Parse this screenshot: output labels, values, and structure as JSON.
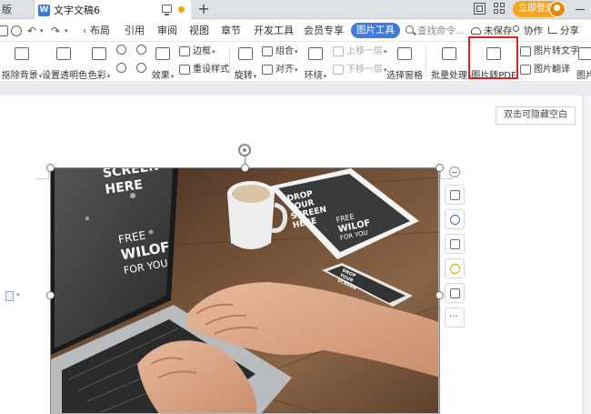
{
  "tabbar": {
    "prev_tab": "版",
    "doc_icon_letter": "W",
    "active_tab": "文字文稿6",
    "new_tab_label": "+",
    "login_label": "立即登录"
  },
  "menubar": {
    "items": {
      "layout": "布局",
      "reference": "引用",
      "review": "审阅",
      "view": "视图",
      "chapter": "章节",
      "devtools": "开发工具",
      "member": "会员专享",
      "picture_tools": "图片工具"
    },
    "search": "查找命令...",
    "unsaved": "未保存",
    "collab": "协作",
    "share": "分享"
  },
  "ribbon": {
    "remove_bg": "抠除背景",
    "set_transparent": "设置透明色",
    "color": "色彩",
    "effects": "效果",
    "border": "边框",
    "reset_style": "重设样式",
    "rotate": "旋转",
    "group": "组合",
    "align": "对齐",
    "wrap": "环绕",
    "bring_forward": "上移一层",
    "send_backward": "下移一层",
    "select_pane": "选择窗格",
    "batch": "批量处理",
    "img_to_pdf": "图片转PDF",
    "img_to_text": "图片转文字",
    "img_translate": "图片翻译",
    "img_more": "图片"
  },
  "document": {
    "hide_space_tip": "双击可隐藏空白"
  },
  "photo": {
    "screen_text": [
      "SCREEN",
      "HERE"
    ],
    "laptop_text": [
      "FREE",
      "WILOF",
      "FOR YOU"
    ],
    "tablet_text": [
      "DROP",
      "YOUR",
      "SCREEN",
      "HERE",
      "FREE",
      "WILOF",
      "FOR YOU"
    ],
    "phone_text": [
      "DROP",
      "YOUR",
      "SCREEN"
    ]
  }
}
